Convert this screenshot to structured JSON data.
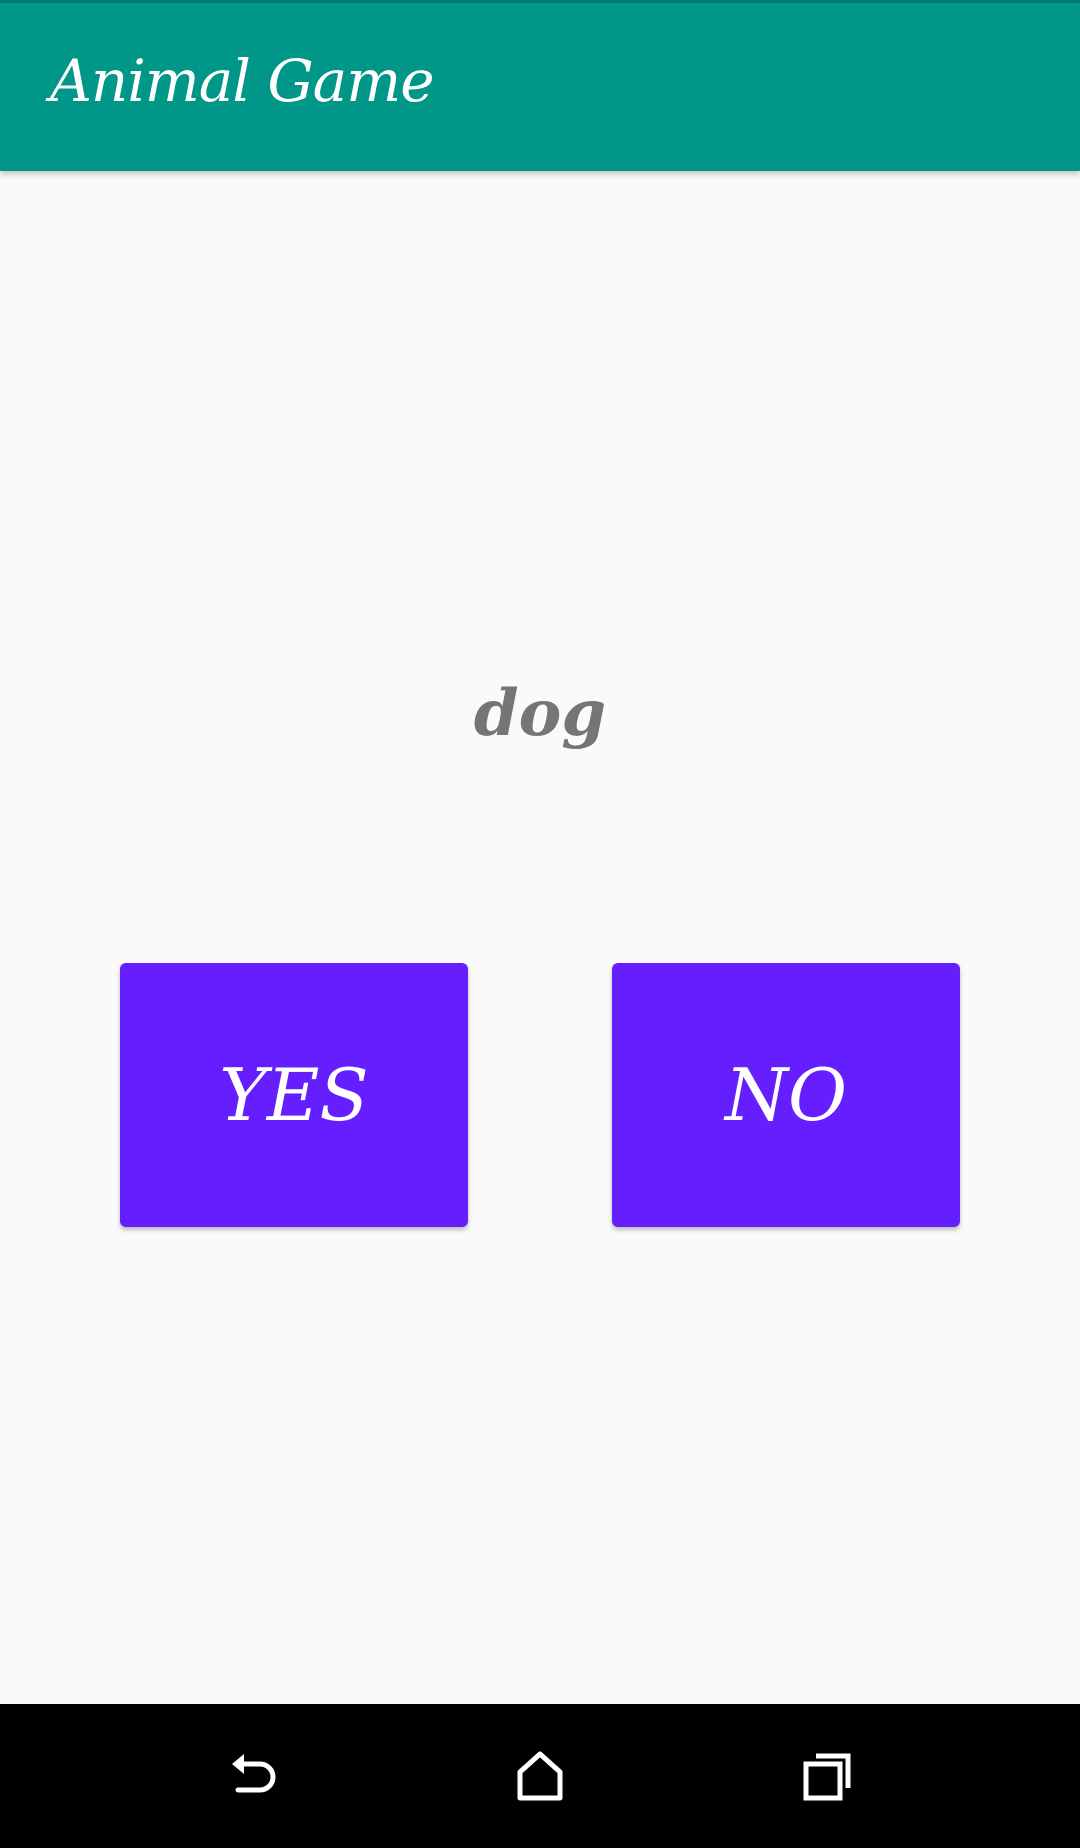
{
  "app_bar": {
    "title": "Animal Game",
    "color": "#009688"
  },
  "game": {
    "animal_word": "dog",
    "yes_label": "YES",
    "no_label": "NO",
    "button_color": "#651fff"
  },
  "nav_bar": {
    "back_icon": "back-icon",
    "home_icon": "home-icon",
    "recents_icon": "recents-icon"
  }
}
